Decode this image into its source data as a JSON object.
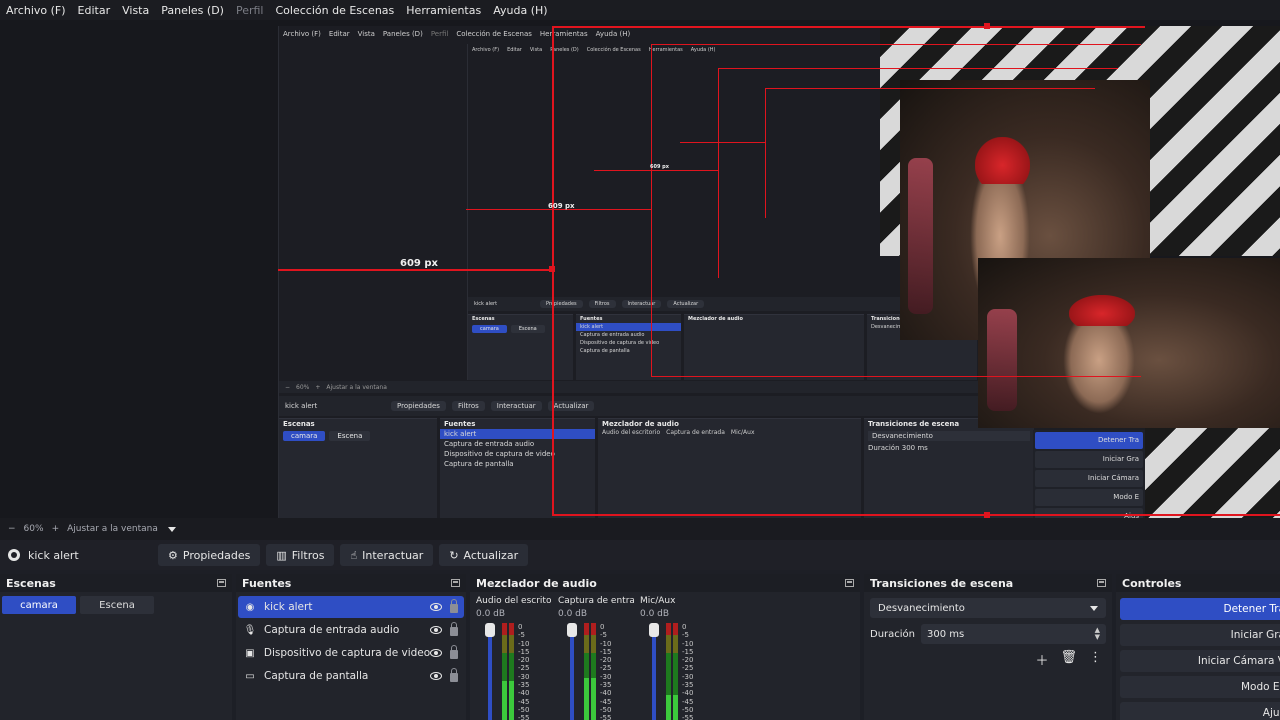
{
  "menu": [
    {
      "label": "Archivo (F)",
      "disabled": false
    },
    {
      "label": "Editar",
      "disabled": false
    },
    {
      "label": "Vista",
      "disabled": false
    },
    {
      "label": "Paneles (D)",
      "disabled": false
    },
    {
      "label": "Perfil",
      "disabled": true
    },
    {
      "label": "Colección de Escenas",
      "disabled": false
    },
    {
      "label": "Herramientas",
      "disabled": false
    },
    {
      "label": "Ayuda (H)",
      "disabled": false
    }
  ],
  "preview": {
    "measure_label_1": "609 px",
    "measure_label_2": "609 px",
    "measure_label_3": "609 px"
  },
  "zoom": {
    "minus": "−",
    "value": "60%",
    "plus": "+",
    "fit": "Ajustar a la ventana"
  },
  "context": {
    "source_name": "kick alert",
    "buttons": {
      "properties": "Propiedades",
      "filters": "Filtros",
      "interact": "Interactuar",
      "refresh": "Actualizar"
    }
  },
  "scenes": {
    "title": "Escenas",
    "items": [
      {
        "label": "camara",
        "selected": true
      },
      {
        "label": "Escena",
        "selected": false
      }
    ]
  },
  "sources": {
    "title": "Fuentes",
    "items": [
      {
        "label": "kick alert",
        "icon": "browser-icon",
        "selected": true
      },
      {
        "label": "Captura de entrada audio",
        "icon": "microphone-icon",
        "selected": false
      },
      {
        "label": "Dispositivo de captura de video",
        "icon": "camera-icon",
        "selected": false
      },
      {
        "label": "Captura de pantalla",
        "icon": "monitor-icon",
        "selected": false
      }
    ]
  },
  "mixer": {
    "title": "Mezclador de audio",
    "channels": [
      {
        "name": "Audio del escritorio",
        "db": "0.0 dB",
        "level": 0.42
      },
      {
        "name": "Captura de entrada",
        "db": "0.0 dB",
        "level": 0.45
      },
      {
        "name": "Mic/Aux",
        "db": "0.0 dB",
        "level": 0.28
      }
    ],
    "scale": [
      "0",
      "-5",
      "-10",
      "-15",
      "-20",
      "-25",
      "-30",
      "-35",
      "-40",
      "-45",
      "-50",
      "-55"
    ]
  },
  "transitions": {
    "title": "Transiciones de escena",
    "selected": "Desvanecimiento",
    "duration_label": "Duración",
    "duration_value": "300 ms"
  },
  "controls": {
    "title": "Controles",
    "buttons": [
      "Detener Tra",
      "Iniciar Gra",
      "Iniciar Cámara V",
      "Modo Es",
      "Ajus"
    ]
  },
  "nested_preview_controls": [
    "Detener Tra",
    "Iniciar Gra",
    "Iniciar Cámara",
    "Modo E",
    "Ajus"
  ],
  "colors": {
    "accent": "#2f4ec4",
    "measure_red": "#e0141e",
    "background": "#1d1f26"
  }
}
